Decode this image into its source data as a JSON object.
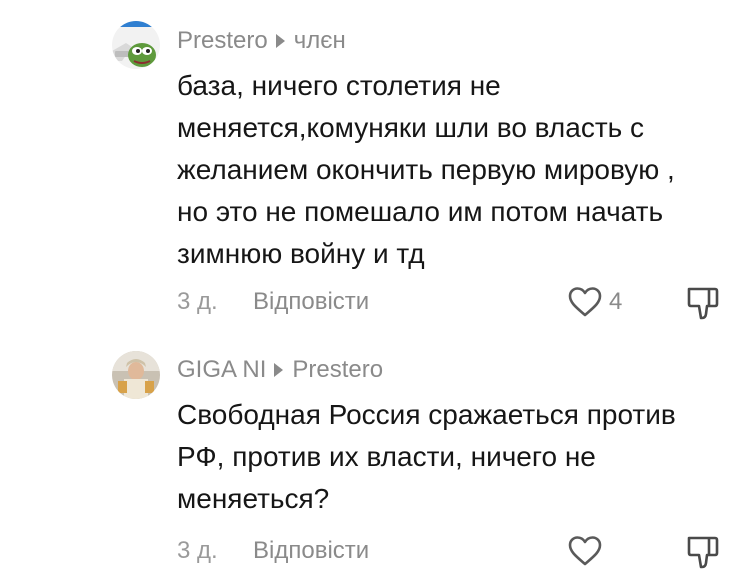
{
  "comments": [
    {
      "username": "Prestero",
      "reply_target": "члєн",
      "text": "база, ничего столетия не\nменяется,комуняки шли во власть с\nжеланием окончить первую мировую ,\nно это не помешало им потом начать\nзимнюю войну и тд",
      "time": "3 д.",
      "reply_label": "Відповісти",
      "like_count": "4",
      "avatar_icon": "pepe-frog-avatar-icon"
    },
    {
      "username": "GIGA NI",
      "reply_target": "Prestero",
      "text": "Свободная Россия сражаеться против\nРФ, против их власти, ничего не\nменяеться?",
      "time": "3 д.",
      "reply_label": "Відповісти",
      "like_count": "",
      "avatar_icon": "person-photo-avatar-icon"
    }
  ],
  "colors": {
    "text": "#161616",
    "muted": "#8a8a8a",
    "background": "#ffffff"
  }
}
